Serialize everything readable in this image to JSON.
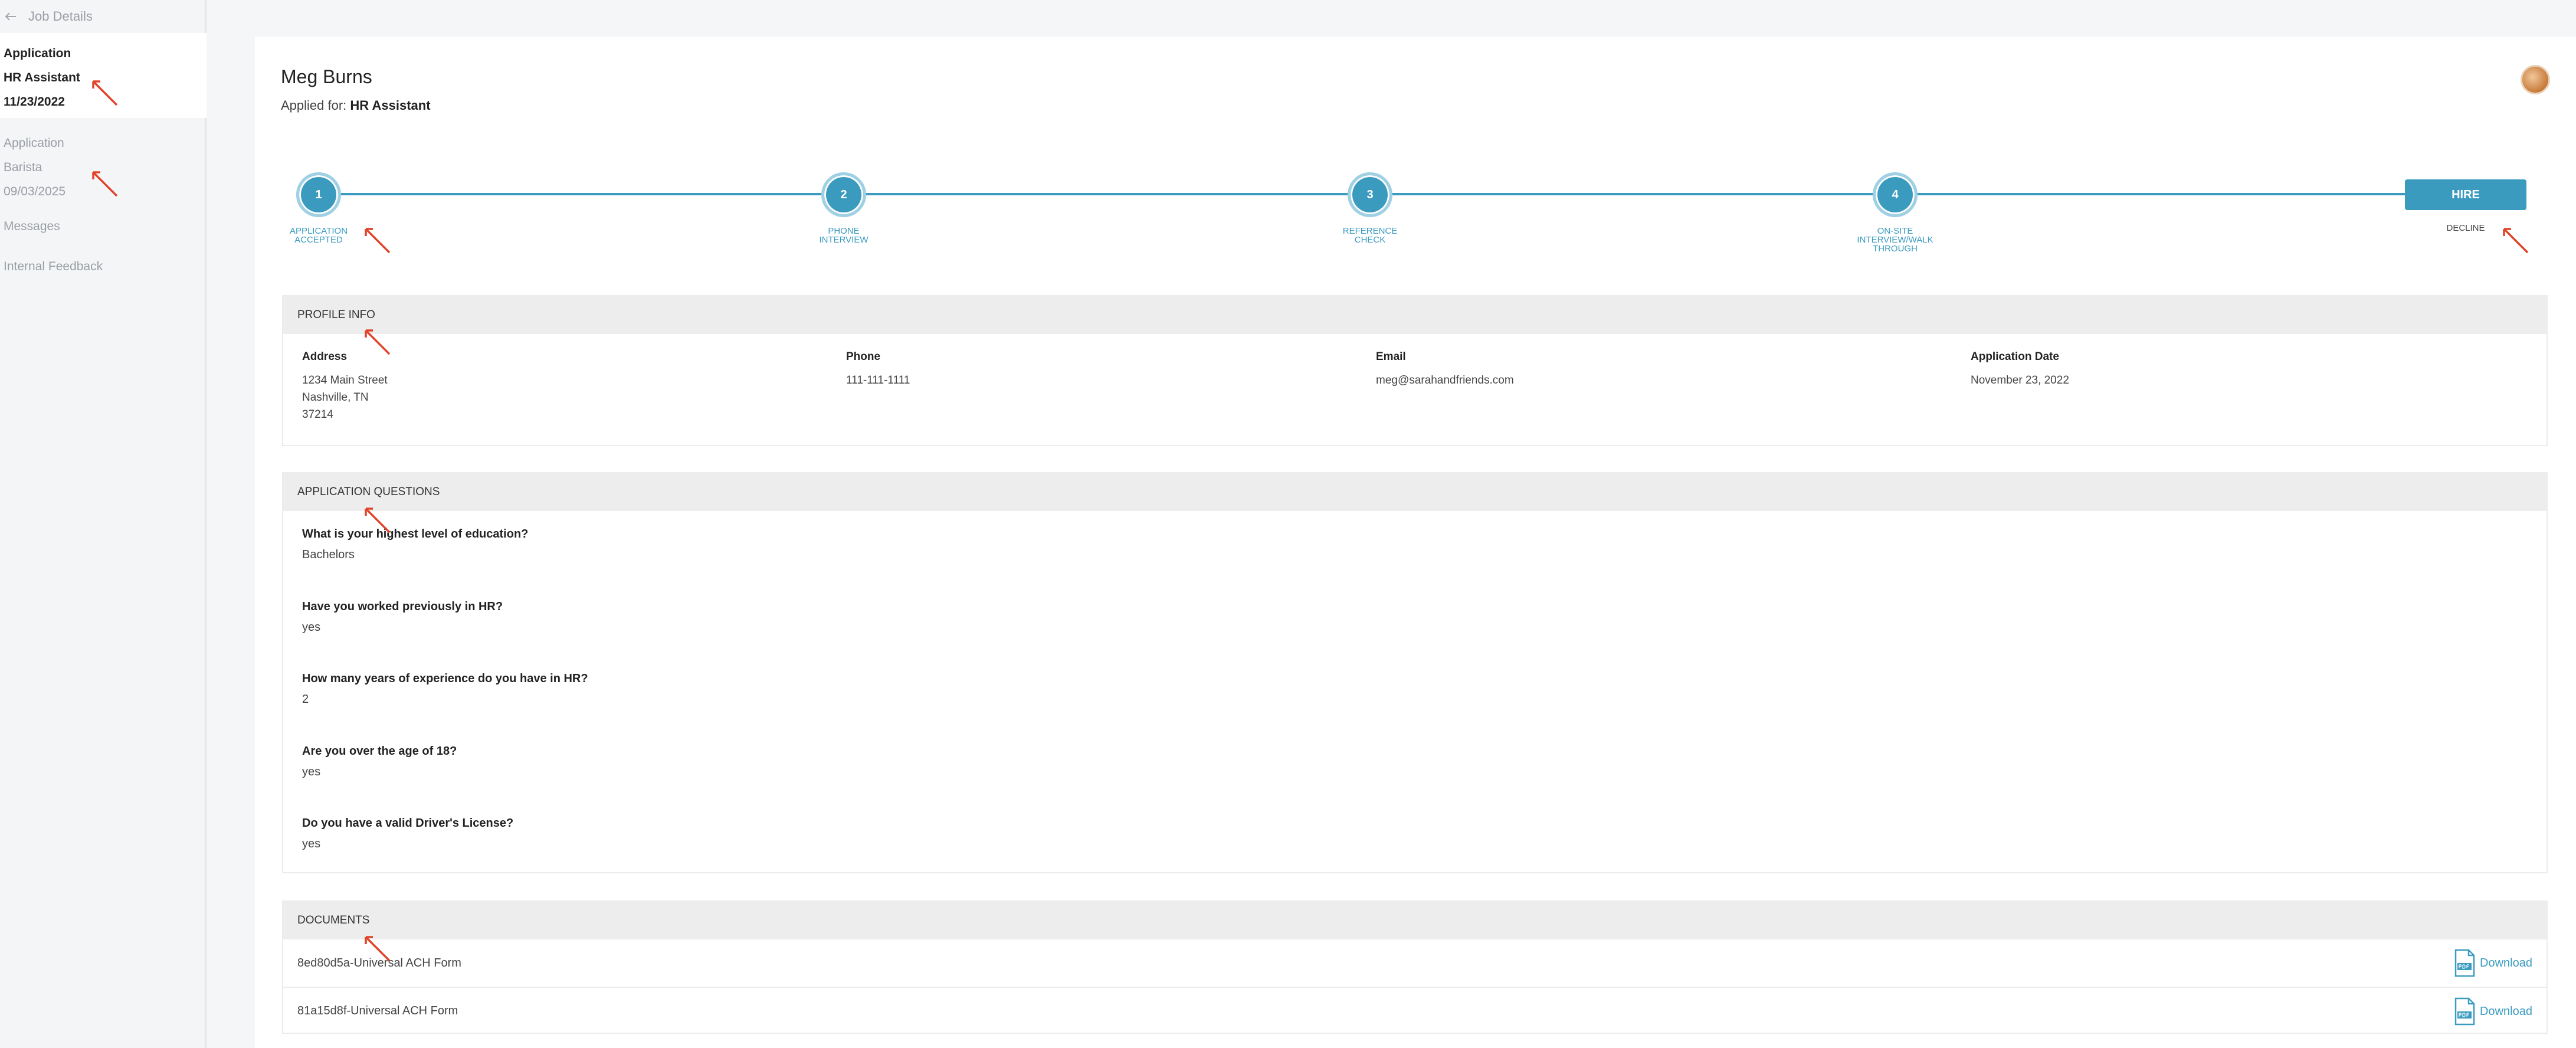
{
  "sidebar": {
    "back_label": "Job Details",
    "applications": [
      {
        "type": "Application",
        "position": "HR Assistant",
        "date": "11/23/2022",
        "active": true
      },
      {
        "type": "Application",
        "position": "Barista",
        "date": "09/03/2025",
        "active": false
      }
    ],
    "links": [
      "Messages",
      "Internal Feedback"
    ]
  },
  "candidate": {
    "name": "Meg Burns",
    "applied_for_label": "Applied for:",
    "applied_for_value": "HR Assistant"
  },
  "stepper": {
    "steps": [
      {
        "number": "1",
        "label_lines": [
          "APPLICATION",
          "ACCEPTED"
        ]
      },
      {
        "number": "2",
        "label_lines": [
          "PHONE",
          "INTERVIEW"
        ]
      },
      {
        "number": "3",
        "label_lines": [
          "REFERENCE",
          "CHECK"
        ]
      },
      {
        "number": "4",
        "label_lines": [
          "ON-SITE",
          "INTERVIEW/WALK",
          "THROUGH"
        ]
      }
    ],
    "hire_label": "HIRE",
    "decline_label": "DECLINE"
  },
  "profile": {
    "title": "PROFILE INFO",
    "address_label": "Address",
    "address_lines": [
      "1234 Main Street",
      "Nashville, TN",
      "37214"
    ],
    "phone_label": "Phone",
    "phone": "111-111-1111",
    "email_label": "Email",
    "email": "meg@sarahandfriends.com",
    "date_label": "Application Date",
    "date": "November 23, 2022"
  },
  "questions": {
    "title": "APPLICATION QUESTIONS",
    "items": [
      {
        "q": "What is your highest level of education?",
        "a": "Bachelors"
      },
      {
        "q": "Have you worked previously in HR?",
        "a": "yes"
      },
      {
        "q": "How many years of experience do you have in HR?",
        "a": "2"
      },
      {
        "q": "Are you over the age of 18?",
        "a": "yes"
      },
      {
        "q": "Do you have a valid Driver's License?",
        "a": "yes"
      }
    ]
  },
  "documents": {
    "title": "DOCUMENTS",
    "items": [
      {
        "name": "8ed80d5a-Universal ACH Form",
        "action": "Download"
      },
      {
        "name": "81a15d8f-Universal ACH Form",
        "action": "Download"
      }
    ]
  },
  "colors": {
    "accent": "#3a9bbf",
    "annotation": "#e0442a"
  }
}
